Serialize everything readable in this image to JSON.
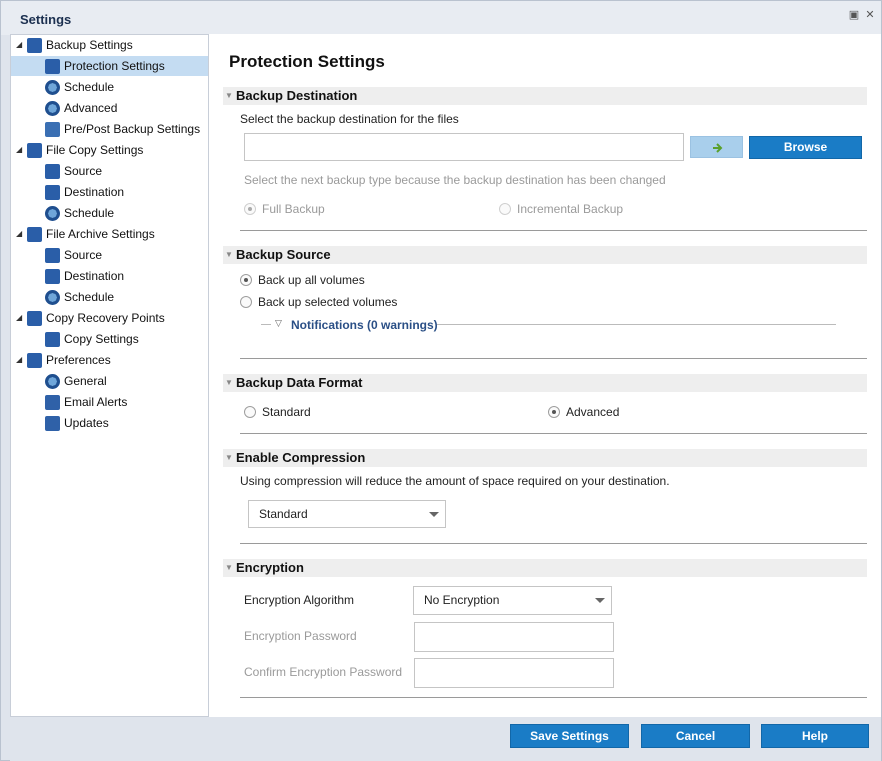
{
  "window": {
    "title": "Settings"
  },
  "tree": {
    "items": [
      {
        "label": "Backup Settings",
        "icon": "backup-icon",
        "level": 0
      },
      {
        "label": "Protection Settings",
        "icon": "protection-icon",
        "level": 1,
        "selected": true
      },
      {
        "label": "Schedule",
        "icon": "schedule-icon",
        "level": 1
      },
      {
        "label": "Advanced",
        "icon": "advanced-icon",
        "level": 1
      },
      {
        "label": "Pre/Post Backup Settings",
        "icon": "wrench-icon",
        "level": 1
      },
      {
        "label": "File Copy Settings",
        "icon": "file-copy-icon",
        "level": 0
      },
      {
        "label": "Source",
        "icon": "source-icon",
        "level": 1
      },
      {
        "label": "Destination",
        "icon": "destination-icon",
        "level": 1
      },
      {
        "label": "Schedule",
        "icon": "schedule-icon",
        "level": 1
      },
      {
        "label": "File Archive Settings",
        "icon": "file-archive-icon",
        "level": 0
      },
      {
        "label": "Source",
        "icon": "source-icon",
        "level": 1
      },
      {
        "label": "Destination",
        "icon": "destination-icon",
        "level": 1
      },
      {
        "label": "Schedule",
        "icon": "schedule-icon",
        "level": 1
      },
      {
        "label": "Copy Recovery Points",
        "icon": "copy-recovery-icon",
        "level": 0
      },
      {
        "label": "Copy Settings",
        "icon": "copy-settings-icon",
        "level": 1
      },
      {
        "label": "Preferences",
        "icon": "preferences-icon",
        "level": 0
      },
      {
        "label": "General",
        "icon": "general-icon",
        "level": 1
      },
      {
        "label": "Email Alerts",
        "icon": "email-icon",
        "level": 1
      },
      {
        "label": "Updates",
        "icon": "updates-icon",
        "level": 1
      }
    ]
  },
  "main": {
    "title": "Protection Settings",
    "backup_destination": {
      "heading": "Backup Destination",
      "instruction": "Select the backup destination for the files",
      "path_value": "",
      "browse_label": "Browse",
      "notice": "Select the next backup type because the backup destination has been changed",
      "full_backup": "Full Backup",
      "incremental_backup": "Incremental Backup"
    },
    "backup_source": {
      "heading": "Backup Source",
      "all_volumes": "Back up all volumes",
      "selected_volumes": "Back up selected volumes",
      "notifications": "Notifications (0 warnings)"
    },
    "data_format": {
      "heading": "Backup Data Format",
      "standard": "Standard",
      "advanced": "Advanced"
    },
    "compression": {
      "heading": "Enable Compression",
      "description": "Using compression will reduce the amount of space required on your destination.",
      "selected": "Standard"
    },
    "encryption": {
      "heading": "Encryption",
      "algorithm_label": "Encryption Algorithm",
      "algorithm_selected": "No Encryption",
      "password_label": "Encryption Password",
      "confirm_label": "Confirm Encryption Password"
    }
  },
  "footer": {
    "save_label": "Save Settings",
    "cancel_label": "Cancel",
    "help_label": "Help"
  },
  "colors": {
    "accent": "#1a7cc6",
    "selected_row": "#c4dcf2",
    "heading_title": "#1c3050"
  }
}
